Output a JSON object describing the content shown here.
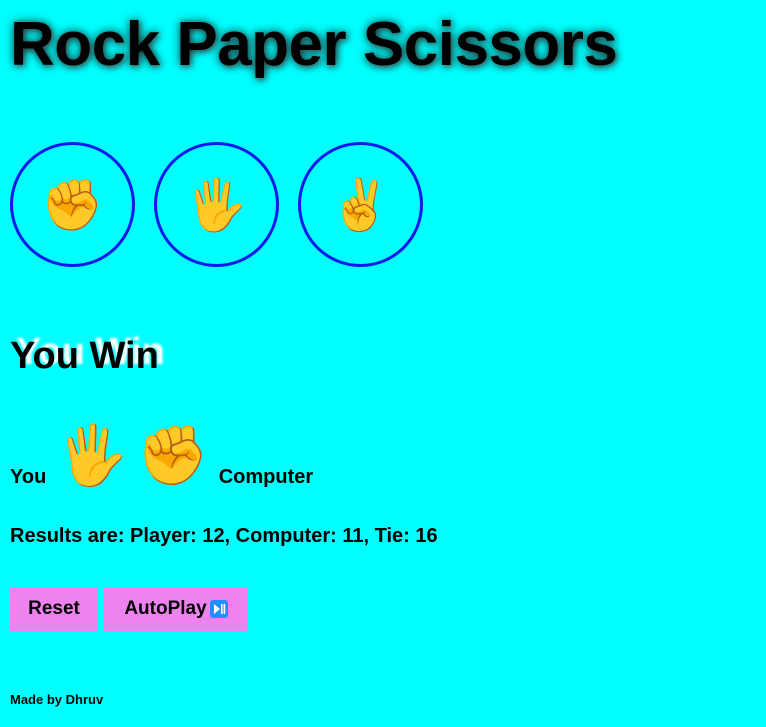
{
  "title": "Rock Paper Scissors",
  "choices": [
    {
      "name": "rock",
      "emoji": "✊"
    },
    {
      "name": "paper",
      "emoji": "🖐"
    },
    {
      "name": "scissors",
      "emoji": "✌"
    }
  ],
  "result": "You Win",
  "moves": {
    "you_label": "You",
    "player_emoji": "🖐",
    "computer_emoji": "✊",
    "computer_label": "Computer"
  },
  "score_text": "Results are: Player: 12, Computer: 11, Tie: 16",
  "buttons": {
    "reset_label": "Reset",
    "autoplay_label": "AutoPlay"
  },
  "footer": "Made by Dhruv",
  "colors": {
    "background": "#00ffff",
    "button_border": "#0f1af0",
    "action_button": "#ee82ee"
  }
}
